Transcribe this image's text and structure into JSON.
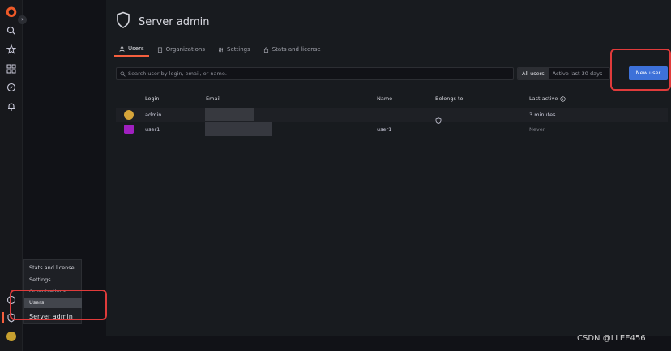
{
  "header": {
    "title": "Server admin"
  },
  "tabs": [
    {
      "label": "Users",
      "icon": "user-icon",
      "active": true
    },
    {
      "label": "Organizations",
      "icon": "building-icon",
      "active": false
    },
    {
      "label": "Settings",
      "icon": "sliders-icon",
      "active": false
    },
    {
      "label": "Stats and license",
      "icon": "lock-icon",
      "active": false
    }
  ],
  "toolbar": {
    "search_placeholder": "Search user by login, email, or name.",
    "filters": [
      "All users",
      "Active last 30 days"
    ],
    "new_user_label": "New user"
  },
  "table": {
    "columns": {
      "login": "Login",
      "email": "Email",
      "name": "Name",
      "belongs_to": "Belongs to",
      "last_active": "Last active"
    },
    "rows": [
      {
        "login": "admin",
        "name": "",
        "last_active": "3 minutes",
        "avatar": "admin-avatar",
        "belongs_icon": "shield-icon"
      },
      {
        "login": "user1",
        "name": "user1",
        "last_active": "Never",
        "avatar": "user1-avatar"
      }
    ]
  },
  "flyout": {
    "items": [
      "Stats and license",
      "Settings",
      "Organizations",
      "Users"
    ],
    "header": "Server admin"
  },
  "watermark": "CSDN @LLEE456",
  "colors": {
    "accent": "#f55f3e",
    "primary": "#3d71d9",
    "highlight": "#e03b3b"
  }
}
